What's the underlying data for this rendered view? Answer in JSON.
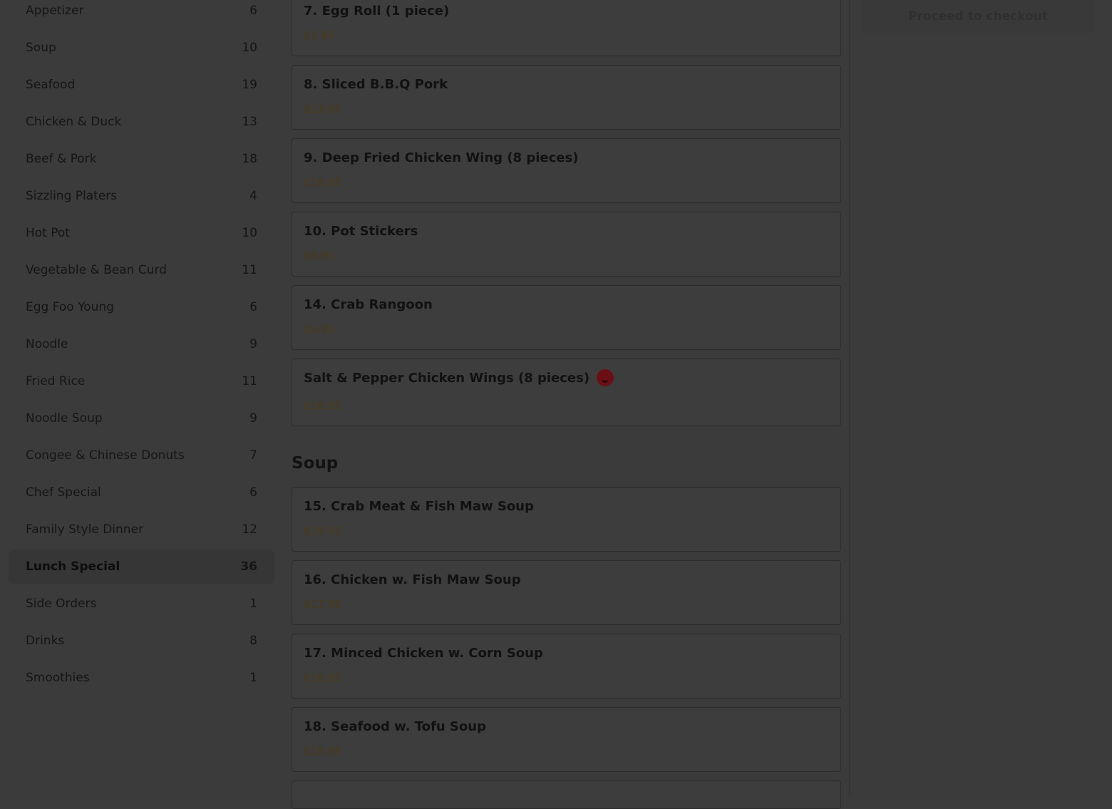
{
  "categories": [
    {
      "label": "Appetizer",
      "count": "6"
    },
    {
      "label": "Soup",
      "count": "10"
    },
    {
      "label": "Seafood",
      "count": "19"
    },
    {
      "label": "Chicken & Duck",
      "count": "13"
    },
    {
      "label": "Beef & Pork",
      "count": "18"
    },
    {
      "label": "Sizzling Platers",
      "count": "4"
    },
    {
      "label": "Hot Pot",
      "count": "10"
    },
    {
      "label": "Vegetable & Bean Curd",
      "count": "11"
    },
    {
      "label": "Egg Foo Young",
      "count": "6"
    },
    {
      "label": "Noodle",
      "count": "9"
    },
    {
      "label": "Fried Rice",
      "count": "11"
    },
    {
      "label": "Noodle Soup",
      "count": "9"
    },
    {
      "label": "Congee & Chinese Donuts",
      "count": "7"
    },
    {
      "label": "Chef Special",
      "count": "6"
    },
    {
      "label": "Family Style Dinner",
      "count": "12"
    },
    {
      "label": "Lunch Special",
      "count": "36",
      "active": true
    },
    {
      "label": "Side Orders",
      "count": "1"
    },
    {
      "label": "Drinks",
      "count": "8"
    },
    {
      "label": "Smoothies",
      "count": "1"
    }
  ],
  "appetizer_items": [
    {
      "name": "7. Egg Roll (1 piece)",
      "price": "$2.45"
    },
    {
      "name": "8. Sliced B.B.Q Pork",
      "price": "$13.95"
    },
    {
      "name": "9. Deep Fried Chicken Wing (8 pieces)",
      "price": "$16.95"
    },
    {
      "name": "10. Pot Stickers",
      "price": "$9.95"
    },
    {
      "name": "14. Crab Rangoon",
      "price": "$9.95"
    },
    {
      "name": "Salt & Pepper Chicken Wings (8 pieces)",
      "price": "$16.95",
      "icon": "spicy-pepper-icon"
    }
  ],
  "soup_section": {
    "heading": "Soup",
    "items": [
      {
        "name": "15. Crab Meat & Fish Maw Soup",
        "price": "$19.95"
      },
      {
        "name": "16. Chicken w. Fish Maw Soup",
        "price": "$17.95"
      },
      {
        "name": "17. Minced Chicken w. Corn Soup",
        "price": "$16.95"
      },
      {
        "name": "18. Seafood w. Tofu Soup",
        "price": "$18.95"
      }
    ]
  },
  "cart": {
    "checkout_label": "Proceed to checkout"
  },
  "colors": {
    "overlay_bg": "#3b3b3b",
    "price": "#4a3a18",
    "spicy": "#6a0f16"
  }
}
